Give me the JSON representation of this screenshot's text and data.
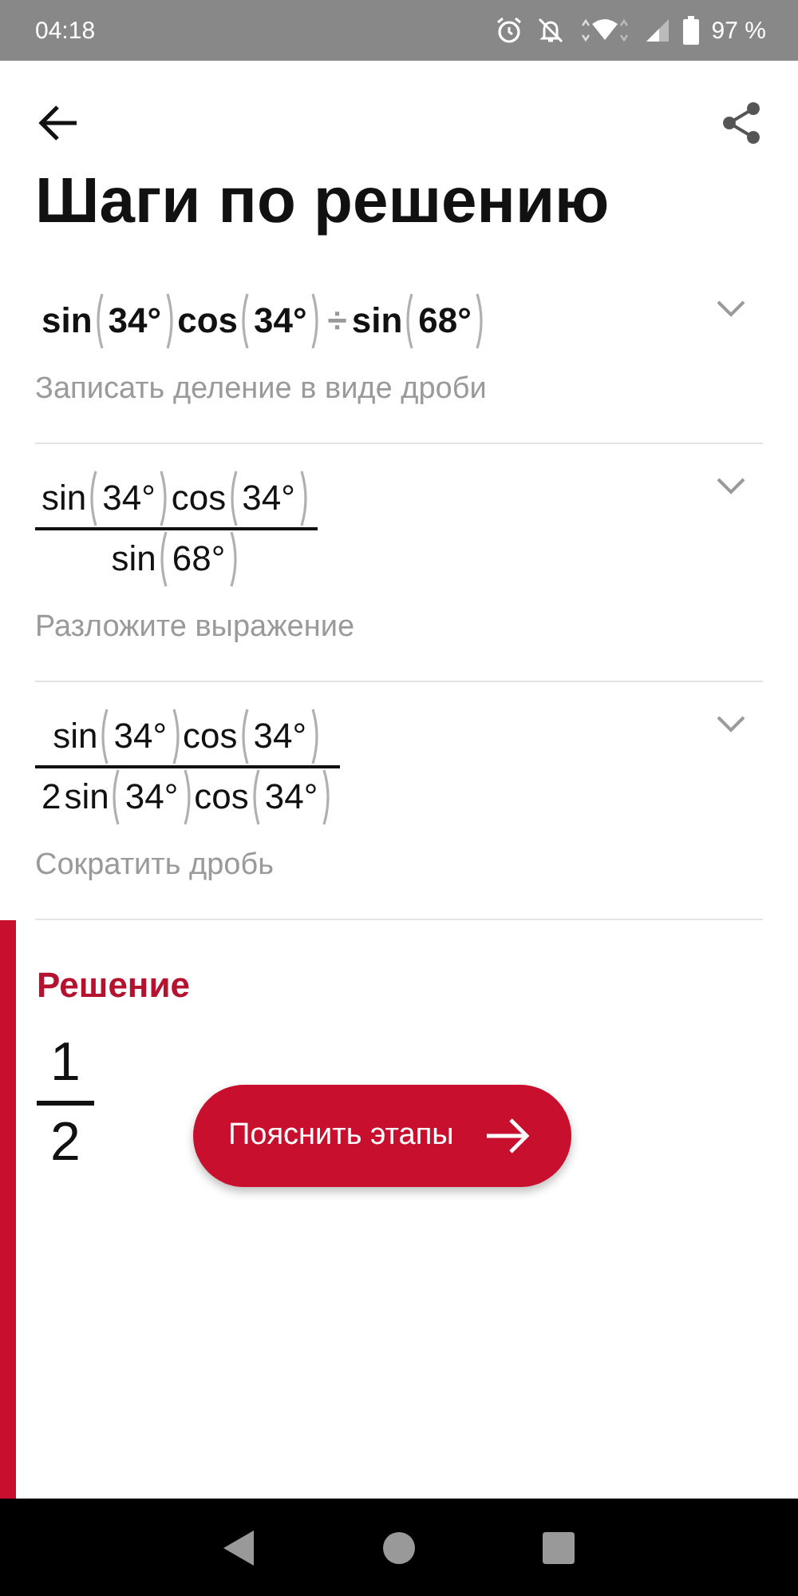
{
  "status_bar": {
    "time": "04:18",
    "battery": "97 %"
  },
  "header": {
    "title": "Шаги по решению"
  },
  "steps": [
    {
      "expanded": false,
      "description": "Записать деление в виде дроби",
      "expression": {
        "kind": "inline",
        "tokens": [
          {
            "kind": "func",
            "text": "sin"
          },
          {
            "kind": "arg",
            "text": "34°"
          },
          {
            "kind": "func",
            "text": "cos"
          },
          {
            "kind": "arg",
            "text": "34°"
          },
          {
            "kind": "op",
            "text": "÷"
          },
          {
            "kind": "func",
            "text": "sin"
          },
          {
            "kind": "arg",
            "text": "68°"
          }
        ]
      }
    },
    {
      "expanded": false,
      "description": "Разложите выражение",
      "expression": {
        "kind": "fraction",
        "numerator": [
          {
            "kind": "func",
            "text": "sin"
          },
          {
            "kind": "arg",
            "text": "34°"
          },
          {
            "kind": "func",
            "text": "cos"
          },
          {
            "kind": "arg",
            "text": "34°"
          }
        ],
        "denominator": [
          {
            "kind": "func",
            "text": "sin"
          },
          {
            "kind": "arg",
            "text": "68°"
          }
        ]
      }
    },
    {
      "expanded": false,
      "description": "Сократить дробь",
      "expression": {
        "kind": "fraction",
        "numerator": [
          {
            "kind": "func",
            "text": "sin"
          },
          {
            "kind": "arg",
            "text": "34°"
          },
          {
            "kind": "func",
            "text": "cos"
          },
          {
            "kind": "arg",
            "text": "34°"
          }
        ],
        "denominator": [
          {
            "kind": "num",
            "text": "2"
          },
          {
            "kind": "func",
            "text": "sin"
          },
          {
            "kind": "arg",
            "text": "34°"
          },
          {
            "kind": "func",
            "text": "cos"
          },
          {
            "kind": "arg",
            "text": "34°"
          }
        ]
      }
    }
  ],
  "solution": {
    "label": "Решение",
    "numerator": "1",
    "denominator": "2"
  },
  "explain_button": {
    "label": "Пояснить этапы"
  }
}
